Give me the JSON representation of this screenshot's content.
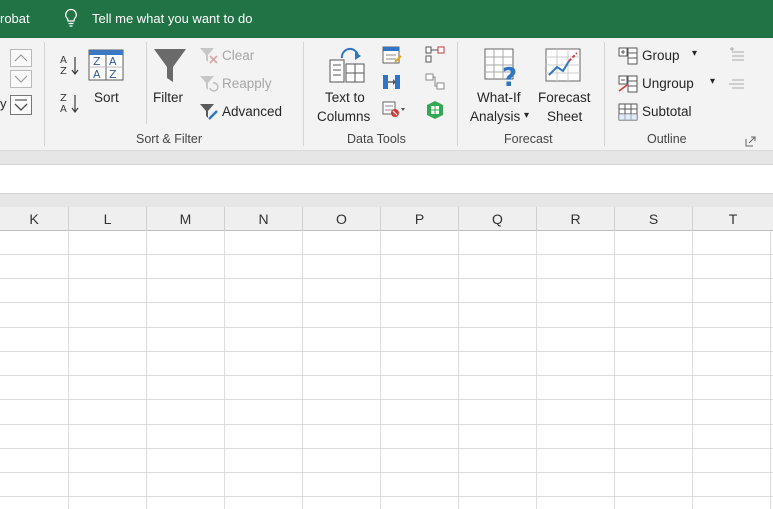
{
  "topbar": {
    "acrobat_tab": "robat",
    "tell_me": "Tell me what you want to do"
  },
  "ribbon": {
    "sort_filter": {
      "sort": "Sort",
      "filter": "Filter",
      "clear": "Clear",
      "reapply": "Reapply",
      "advanced": "Advanced",
      "group_label": "Sort & Filter"
    },
    "data_tools": {
      "text_to_columns_1": "Text to",
      "text_to_columns_2": "Columns",
      "group_label": "Data Tools"
    },
    "forecast": {
      "what_if_1": "What-If",
      "what_if_2": "Analysis",
      "what_if_arrow": "▾",
      "forecast_sheet_1": "Forecast",
      "forecast_sheet_2": "Sheet",
      "group_label": "Forecast"
    },
    "outline": {
      "group": "Group",
      "ungroup": "Ungroup",
      "subtotal": "Subtotal",
      "group_label": "Outline"
    }
  },
  "columns": [
    "K",
    "L",
    "M",
    "N",
    "O",
    "P",
    "Q",
    "R",
    "S",
    "T"
  ],
  "colors": {
    "title_bar": "#217346",
    "ribbon": "#f3f3f3",
    "gridline": "#dcdcdc"
  }
}
